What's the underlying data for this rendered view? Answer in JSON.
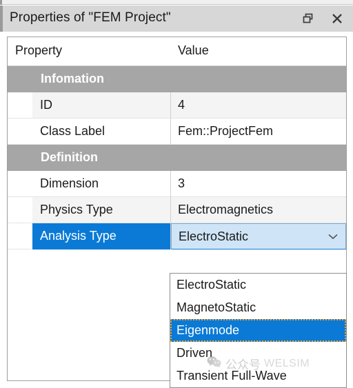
{
  "window": {
    "title": "Properties of \"FEM Project\"",
    "buttons": [
      {
        "name": "float-restore",
        "icon": "restore-icon",
        "label": "Float"
      },
      {
        "name": "close",
        "icon": "close-icon",
        "label": "Close"
      }
    ]
  },
  "table": {
    "columns": [
      "Property",
      "Value"
    ],
    "sections": [
      {
        "header": "Infomation",
        "rows": [
          {
            "property": "ID",
            "value": "4"
          },
          {
            "property": "Class Label",
            "value": "Fem::ProjectFem"
          }
        ]
      },
      {
        "header": "Definition",
        "rows": [
          {
            "property": "Dimension",
            "value": "3"
          },
          {
            "property": "Physics Type",
            "value": "Electromagnetics"
          },
          {
            "property": "Analysis Type",
            "value": "ElectroStatic"
          }
        ]
      }
    ]
  },
  "dropdown": {
    "open": true,
    "selected_value": "ElectroStatic",
    "highlighted": "Eigenmode",
    "chevron_icon": "chevron-down-icon",
    "options": [
      "ElectroStatic",
      "MagnetoStatic",
      "Eigenmode",
      "Driven",
      "Transient Full-Wave"
    ]
  },
  "watermark": {
    "icon": "wechat-icon",
    "text_cn": "公众号",
    "text_en": "WELSIM"
  },
  "colors": {
    "titlebar_bg": "#d7d7d7",
    "section_header_bg": "#a6a6a6",
    "selection_blue": "#0a7ad6",
    "combobox_bg": "#cfe5f7",
    "focus_outline": "#f0a030",
    "alt_row_bg": "#f4f4f4"
  }
}
